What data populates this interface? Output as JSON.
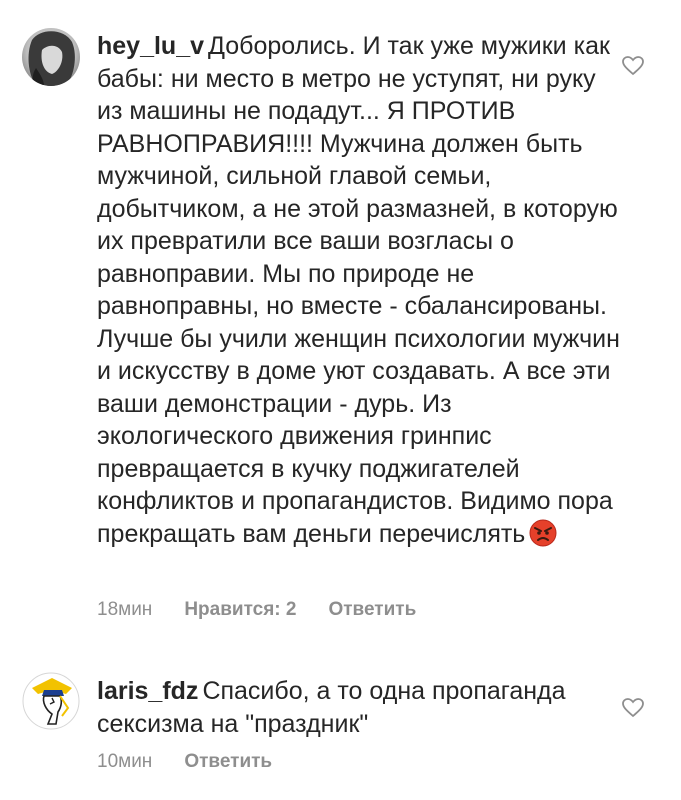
{
  "comments": [
    {
      "username": "hey_lu_v",
      "text": "Доборолись. И так уже мужики как бабы: ни место в метро не уступят, ни руку из машины не подадут... Я ПРОТИВ РАВНОПРАВИЯ!!!! Мужчина должен быть мужчиной, сильной главой семьи, добытчиком, а не этой размазней, в которую их превратили все ваши возгласы о равноправии. Мы по природе не равноправны, но вместе - сбалансированы. Лучше бы учили женщин психологии мужчин и искусству в доме уют создавать. А все эти ваши демонстрации - дурь. Из экологического движения гринпис превращается в кучку поджигателей конфликтов и пропагандистов. Видимо пора прекращать вам деньги перечислять",
      "emoji_icon": "angry-face-icon",
      "time": "18мин",
      "likes": "Нравится: 2",
      "reply": "Ответить"
    },
    {
      "username": "laris_fdz",
      "text": "Спасибо, а то одна пропаганда сексизма на \"праздник\"",
      "time": "10мин",
      "reply": "Ответить"
    }
  ],
  "icons": {
    "like": "heart-outline-icon",
    "avatar1": "avatar",
    "avatar2": "avatar"
  },
  "colors": {
    "text": "#262626",
    "meta": "#8e8e8e",
    "emoji_red": "#e5402a"
  }
}
